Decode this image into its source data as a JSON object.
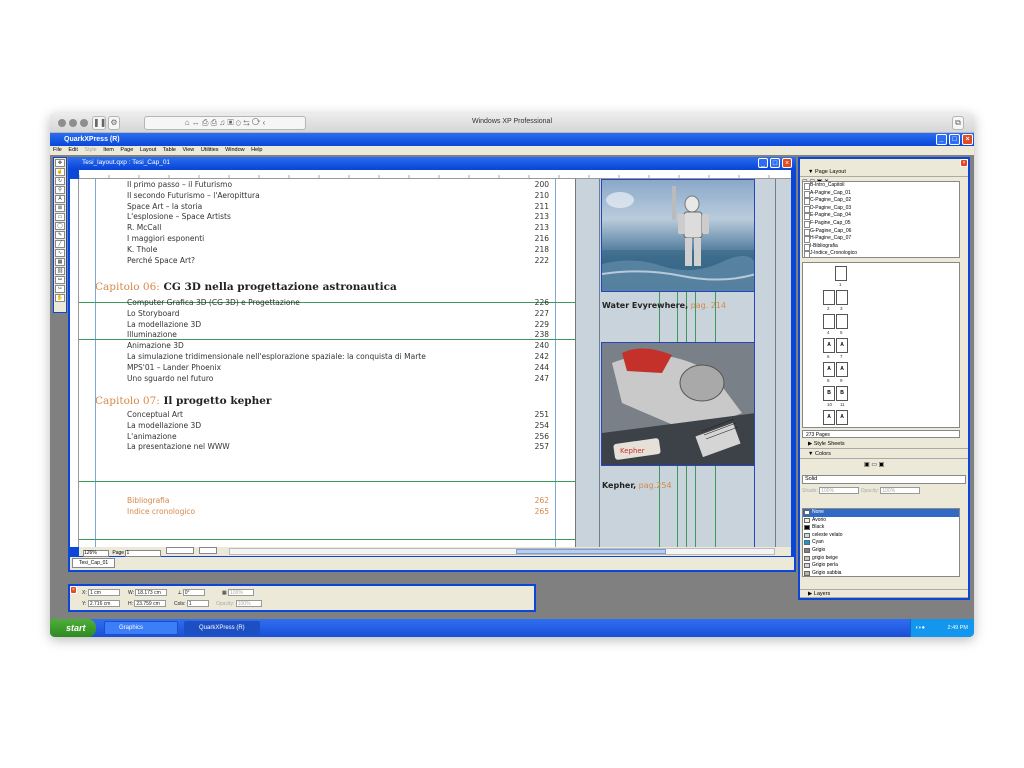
{
  "window": {
    "title": "Windows XP Professional"
  },
  "app": {
    "title": "QuarkXPress (R)",
    "menu": [
      "File",
      "Edit",
      "Style",
      "Item",
      "Page",
      "Layout",
      "Table",
      "View",
      "Utilities",
      "Window",
      "Help"
    ]
  },
  "document": {
    "title": "Tesi_layout.qxp : Tesi_Cap_01",
    "zoom": "126%",
    "page_label": "Page",
    "page_value": "1",
    "tab": "Tesi_Cap_01"
  },
  "toc": {
    "group1": [
      {
        "t": "Il primo passo – il Futurismo",
        "p": "200"
      },
      {
        "t": "Il secondo Futurismo – l'Aeropittura",
        "p": "210"
      },
      {
        "t": "Space Art – la storia",
        "p": "211"
      },
      {
        "t": "L'esplosione – Space Artists",
        "p": "213"
      },
      {
        "t": "R. McCall",
        "p": "213"
      },
      {
        "t": "I maggiori esponenti",
        "p": "216"
      },
      {
        "t": "K. Thole",
        "p": "218"
      },
      {
        "t": "Perché Space Art?",
        "p": "222"
      }
    ],
    "chapter6": {
      "label": "Capitolo 06:",
      "title": " CG 3D nella progettazione astronautica"
    },
    "group2": [
      {
        "t": "Computer Grafica 3D (CG 3D) e Progettazione",
        "p": "226"
      },
      {
        "t": "Lo Storyboard",
        "p": "227"
      },
      {
        "t": "La modellazione 3D",
        "p": "229"
      },
      {
        "t": "Illuminazione",
        "p": "238"
      },
      {
        "t": "Animazione 3D",
        "p": "240"
      },
      {
        "t": "La simulazione tridimensionale nell'esplorazione spaziale: la conquista di Marte",
        "p": "242"
      },
      {
        "t": "MPS'01 – Lander Phoenix",
        "p": "244"
      },
      {
        "t": "Uno sguardo nel futuro",
        "p": "247"
      }
    ],
    "chapter7": {
      "label": "Capitolo 07:",
      "title": " Il progetto kepher"
    },
    "group3": [
      {
        "t": "Conceptual Art",
        "p": "251"
      },
      {
        "t": "La modellazione 3D",
        "p": "254"
      },
      {
        "t": "L'animazione",
        "p": "256"
      },
      {
        "t": "La presentazione nel WWW",
        "p": "257"
      }
    ],
    "group4": [
      {
        "t": "Bibliografia",
        "p": "262"
      },
      {
        "t": "Indice cronologico",
        "p": "265"
      }
    ]
  },
  "captions": {
    "water": {
      "title": "Water Evyrewhere,",
      "page": " pag. 214"
    },
    "kepher": {
      "title": "Kepher,",
      "page": " pag.254"
    }
  },
  "image_labels": {
    "brand": "Kepher"
  },
  "measurements": {
    "x_label": "X:",
    "x": "1 cm",
    "y_label": "Y:",
    "y": "2.716 cm",
    "w_label": "W:",
    "w": "18.173 cm",
    "h_label": "H:",
    "h": "23.759 cm",
    "angle": "0°",
    "cols_label": "Cols:",
    "cols": "1",
    "pct1": "100%",
    "pct2": "100%",
    "opacity_label": "Opacity:"
  },
  "page_layout": {
    "title": "Page Layout",
    "masters": [
      "B-Intro_Capitoli",
      "A-Pagine_Cap_01",
      "C-Pagine_Cap_02",
      "D-Pagine_Cap_03",
      "E-Pagine_Cap_04",
      "F-Pagine_Cap_05",
      "G-Pagine_Cap_06",
      "H-Pagine_Cap_07",
      "I-Bibliografia",
      "J-Indice_Cronologico"
    ],
    "page_count": "273 Pages",
    "thumbs": [
      {
        "l": "",
        "n": "1"
      },
      {
        "l": "",
        "n": "2",
        "r": "",
        "rn": "3"
      },
      {
        "l": "",
        "n": "4",
        "r": "",
        "rn": "5"
      },
      {
        "l": "A",
        "n": "6",
        "r": "A",
        "rn": "7"
      },
      {
        "l": "A",
        "n": "8",
        "r": "A",
        "rn": "9"
      },
      {
        "l": "B",
        "n": "10",
        "r": "B",
        "rn": "11"
      },
      {
        "l": "A",
        "n": "12",
        "r": "A",
        "rn": "13"
      }
    ]
  },
  "style_sheets": {
    "title": "Style Sheets"
  },
  "colors": {
    "title": "Colors",
    "mode": "Solid",
    "shade_label": "Shade:",
    "shade": "100%",
    "opacity_label": "Opacity:",
    "opacity": "100%",
    "list": [
      {
        "n": "None",
        "c": "#ffffff"
      },
      {
        "n": "Avorio",
        "c": "#f3eedb"
      },
      {
        "n": "Black",
        "c": "#000000"
      },
      {
        "n": "celeste velato",
        "c": "#c9d9e6"
      },
      {
        "n": "Cyan",
        "c": "#00a0e0"
      },
      {
        "n": "Grigio",
        "c": "#808080"
      },
      {
        "n": "grigio beige",
        "c": "#cfc6b4"
      },
      {
        "n": "Grigio perla",
        "c": "#d8d8d8"
      },
      {
        "n": "Grigio sabbia",
        "c": "#bdb4a0"
      }
    ]
  },
  "layers": {
    "title": "Layers"
  },
  "taskbar": {
    "start": "start",
    "tasks": [
      "Graphics",
      "QuarkXPress (R)"
    ],
    "clock": "2:49 PM"
  },
  "accent": {
    "xp_blue": "#0a46d8",
    "orange": "#d6894a",
    "guide": "#3a9a5a"
  }
}
